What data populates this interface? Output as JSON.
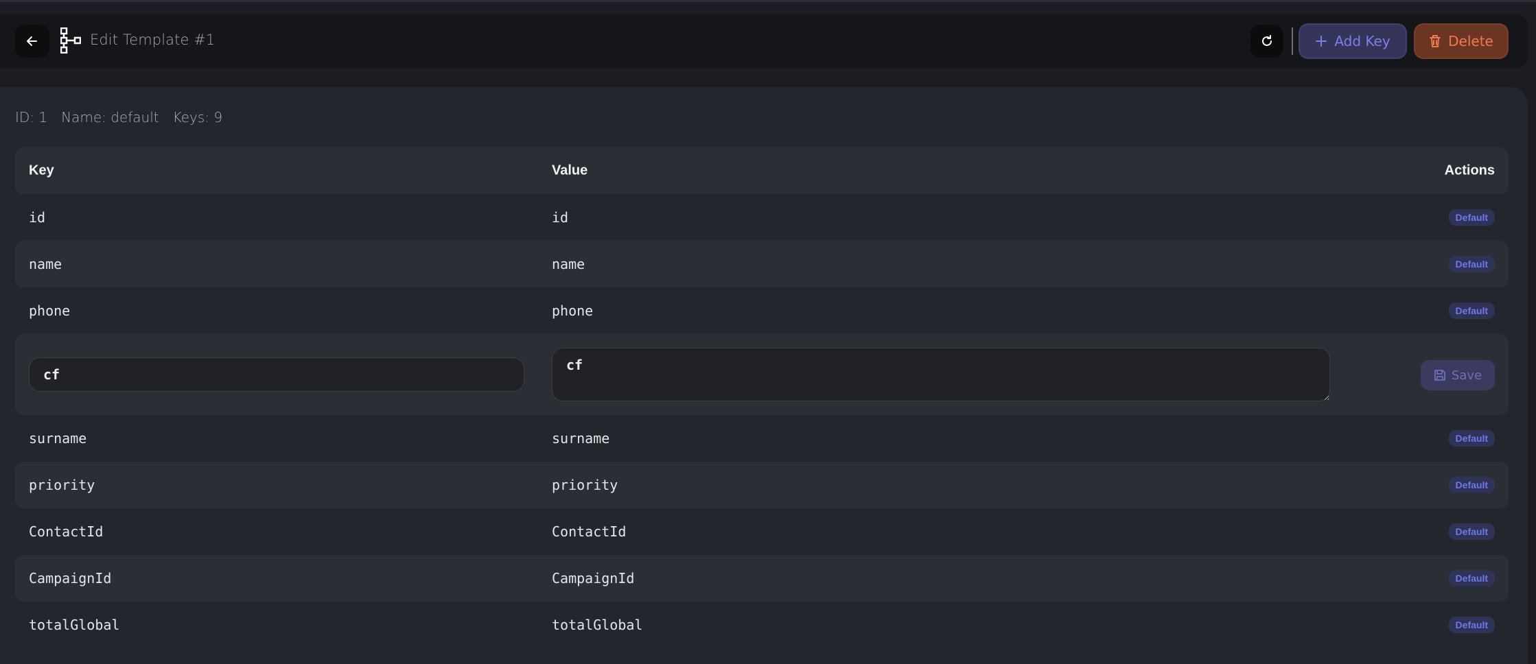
{
  "header": {
    "title": "Edit Template #1",
    "add_key_label": "Add Key",
    "delete_label": "Delete"
  },
  "meta": {
    "id": "ID: 1",
    "name": "Name: default",
    "keys": "Keys: 9"
  },
  "table": {
    "columns": [
      "Key",
      "Value",
      "Actions"
    ],
    "rows": [
      {
        "key": "id",
        "value": "id",
        "badge": "Default"
      },
      {
        "key": "name",
        "value": "name",
        "badge": "Default"
      },
      {
        "key": "phone",
        "value": "phone",
        "badge": "Default"
      },
      {
        "key": "cf",
        "value": "cf",
        "editing": true,
        "action": "Save"
      },
      {
        "key": "surname",
        "value": "surname",
        "badge": "Default"
      },
      {
        "key": "priority",
        "value": "priority",
        "badge": "Default"
      },
      {
        "key": "ContactId",
        "value": "ContactId",
        "badge": "Default"
      },
      {
        "key": "CampaignId",
        "value": "CampaignId",
        "badge": "Default"
      },
      {
        "key": "totalGlobal",
        "value": "totalGlobal",
        "badge": "Default"
      }
    ]
  },
  "colors": {
    "accent": "#7c7fe6",
    "danger": "#f07a4f",
    "badge_text": "#6f78e8"
  },
  "icons": {
    "back": "arrow-left-icon",
    "template": "tree-structure-icon",
    "refresh": "refresh-icon",
    "add": "plus-icon",
    "delete": "trash-icon",
    "save": "floppy-disk-icon"
  }
}
